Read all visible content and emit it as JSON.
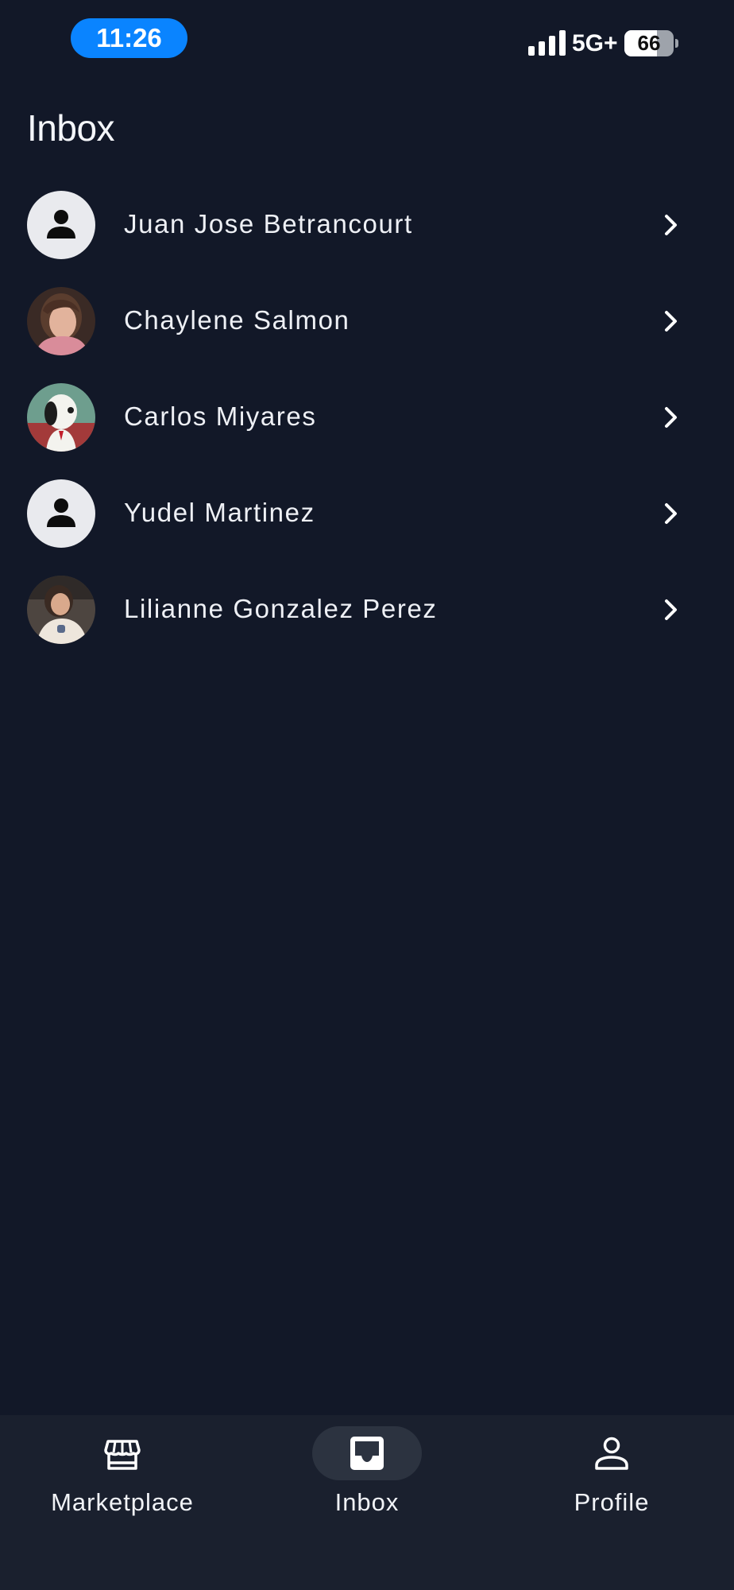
{
  "status_bar": {
    "time": "11:26",
    "network": "5G+",
    "battery_level": "66",
    "battery_fraction": 0.66,
    "signal_bars": 4,
    "time_pill_color": "#0a84ff"
  },
  "header": {
    "title": "Inbox"
  },
  "conversations": [
    {
      "name": "Juan Jose Betrancourt",
      "avatar": "person-placeholder-icon"
    },
    {
      "name": "Chaylene Salmon",
      "avatar": "photo"
    },
    {
      "name": "Carlos Miyares",
      "avatar": "photo"
    },
    {
      "name": "Yudel Martinez",
      "avatar": "person-placeholder-icon"
    },
    {
      "name": "Lilianne Gonzalez Perez",
      "avatar": "photo"
    }
  ],
  "bottom_nav": {
    "active": "Inbox",
    "items": [
      {
        "label": "Marketplace",
        "icon": "storefront-icon"
      },
      {
        "label": "Inbox",
        "icon": "inbox-icon"
      },
      {
        "label": "Profile",
        "icon": "person-icon"
      }
    ]
  },
  "colors": {
    "background": "#121828",
    "nav_background": "#1a202e",
    "active_nav_pill": "#2c3340",
    "text": "#f1f3f7"
  }
}
